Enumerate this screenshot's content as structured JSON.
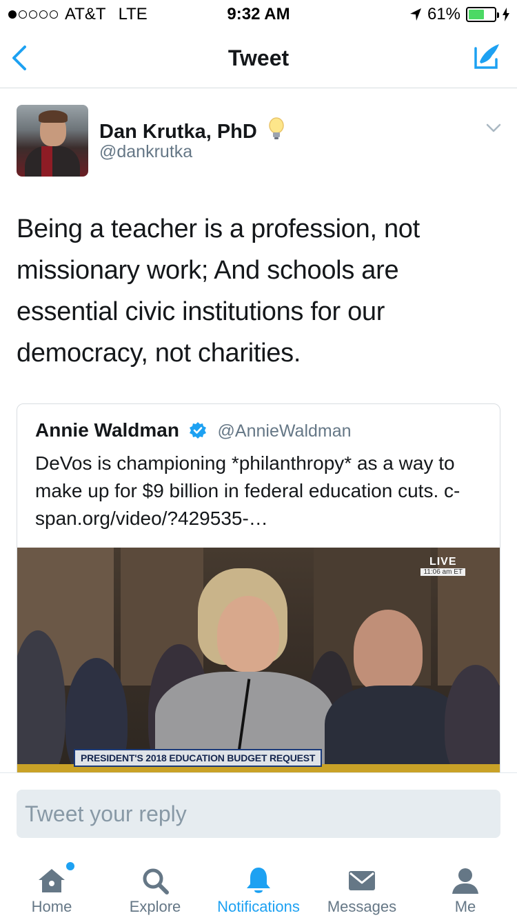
{
  "status_bar": {
    "carrier": "AT&T",
    "network": "LTE",
    "time": "9:32 AM",
    "battery": "61%",
    "battery_level": 0.61
  },
  "nav": {
    "title": "Tweet"
  },
  "tweet": {
    "author_name": "Dan Krutka, PhD",
    "author_handle": "@dankrutka",
    "text": "Being a teacher is a profession, not missionary work; And schools are essential civic institutions for our democracy, not charities."
  },
  "quoted": {
    "author_name": "Annie Waldman",
    "author_handle": "@AnnieWaldman",
    "text": "DeVos is championing *philanthropy* as a way to make up for $9 billion in federal education cuts. c-span.org/video/?429535-…",
    "media": {
      "live_label": "LIVE",
      "live_time": "11:06 am ET",
      "chyron": "PRESIDENT'S 2018 EDUCATION BUDGET REQUEST"
    }
  },
  "reply": {
    "placeholder": "Tweet your reply"
  },
  "tabs": [
    {
      "label": "Home",
      "icon": "home-icon"
    },
    {
      "label": "Explore",
      "icon": "search-icon"
    },
    {
      "label": "Notifications",
      "icon": "bell-icon",
      "active": true
    },
    {
      "label": "Messages",
      "icon": "envelope-icon"
    },
    {
      "label": "Me",
      "icon": "person-icon"
    }
  ],
  "colors": {
    "accent": "#1da1f2",
    "text_primary": "#14171a",
    "text_secondary": "#657786",
    "battery_fill": "#4cd964"
  }
}
